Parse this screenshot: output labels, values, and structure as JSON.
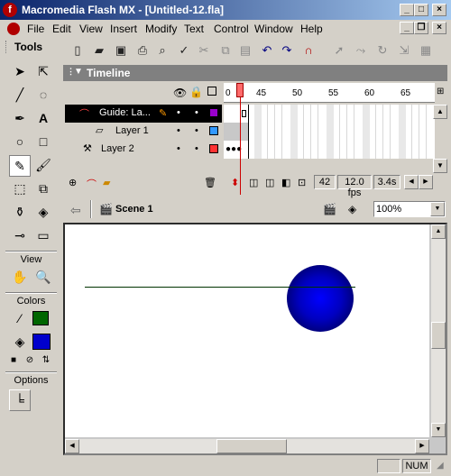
{
  "window": {
    "title": "Macromedia Flash MX - [Untitled-12.fla]",
    "app_icon_glyph": "f",
    "minimize": "_",
    "maximize": "□",
    "close": "×"
  },
  "menus": [
    "File",
    "Edit",
    "View",
    "Insert",
    "Modify",
    "Text",
    "Control",
    "Window",
    "Help"
  ],
  "tools": {
    "title": "Tools",
    "view_label": "View",
    "colors_label": "Colors",
    "options_label": "Options",
    "stroke_color": "#006600",
    "fill_color": "#0000cc"
  },
  "timeline": {
    "title": "Timeline",
    "ruler_numbers": [
      "0",
      "45",
      "50",
      "55",
      "60",
      "65"
    ],
    "layers": [
      {
        "name": "Guide: La...",
        "color": "#9900cc",
        "selected": true
      },
      {
        "name": "Layer 1",
        "color": "#3399ff",
        "selected": false
      },
      {
        "name": "Layer 2",
        "color": "#ff3333",
        "selected": false
      }
    ],
    "current_frame": "42",
    "fps": "12.0 fps",
    "elapsed": "3.4s"
  },
  "scene": {
    "name": "Scene 1",
    "zoom": "100%"
  },
  "status": {
    "num": "NUM"
  },
  "colors": {
    "title_bar_start": "#0a246a",
    "title_bar_end": "#a6caf0",
    "ball": "#0000ff",
    "guide_line": "#003300"
  }
}
